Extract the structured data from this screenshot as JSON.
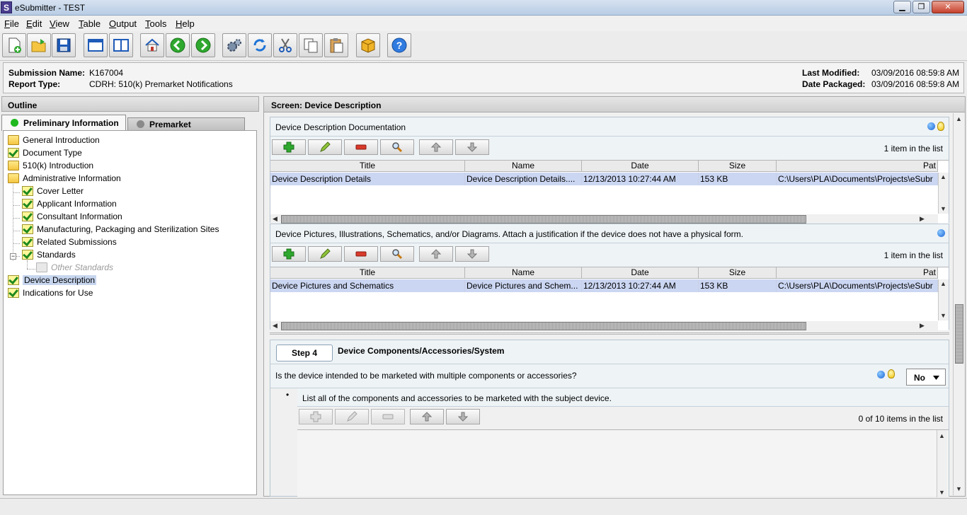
{
  "window": {
    "icon_letter": "S",
    "title": "eSubmitter - TEST",
    "minimize": "▁",
    "maximize": "❐",
    "close": "✕"
  },
  "menu": [
    {
      "mn": "F",
      "rest": "ile"
    },
    {
      "mn": "E",
      "rest": "dit"
    },
    {
      "mn": "V",
      "rest": "iew"
    },
    {
      "mn": "T",
      "rest": "able"
    },
    {
      "mn": "O",
      "rest": "utput"
    },
    {
      "mn": "T",
      "rest": "ools"
    },
    {
      "mn": "H",
      "rest": "elp"
    }
  ],
  "toolbar_icons": [
    "new-document-icon",
    "open-folder-icon",
    "save-icon",
    "window-icon",
    "split-view-icon",
    "home-icon",
    "back-arrow-icon",
    "forward-arrow-icon",
    "settings-gears-icon",
    "refresh-icon",
    "cut-icon",
    "copy-icon",
    "paste-icon",
    "package-icon",
    "help-icon"
  ],
  "submission": {
    "name_label": "Submission Name:",
    "name_value": "K167004",
    "type_label": "Report Type:",
    "type_value": "CDRH: 510(k) Premarket Notifications",
    "modified_label": "Last Modified:",
    "modified_value": "03/09/2016 08:59:8 AM",
    "packaged_label": "Date Packaged:",
    "packaged_value": "03/09/2016 08:59:8 AM"
  },
  "outline": {
    "header": "Outline",
    "tabs": [
      {
        "label": "Preliminary Information",
        "status_color": "#1fb81f"
      },
      {
        "label": "Premarket Notification",
        "status_color": "#8a8a8a"
      }
    ],
    "nodes": [
      {
        "label": "General Introduction",
        "icon": "folder"
      },
      {
        "label": "Document Type",
        "icon": "check"
      },
      {
        "label": "510(k) Introduction",
        "icon": "folder"
      },
      {
        "label": "Administrative Information",
        "icon": "folder"
      },
      {
        "label": "Cover Letter",
        "icon": "check"
      },
      {
        "label": "Applicant Information",
        "icon": "check"
      },
      {
        "label": "Consultant Information",
        "icon": "check"
      },
      {
        "label": "Manufacturing, Packaging and Sterilization Sites",
        "icon": "check"
      },
      {
        "label": "Related Submissions",
        "icon": "check"
      },
      {
        "label": "Standards",
        "icon": "check"
      },
      {
        "label": "Other Standards",
        "icon": "folder-disabled"
      },
      {
        "label": "Device Description",
        "icon": "check"
      },
      {
        "label": "Indications for Use",
        "icon": "check"
      }
    ],
    "expander": "−"
  },
  "screen": {
    "header": "Screen: Device Description",
    "section1": {
      "title": "Device Description Documentation",
      "count": "1 item in the list",
      "columns": [
        "Title",
        "Name",
        "Date",
        "Size",
        "Pat"
      ],
      "row": [
        "Device Description Details",
        "Device Description Details....",
        "12/13/2013 10:27:44 AM",
        "153 KB",
        "C:\\Users\\PLA\\Documents\\Projects\\eSubr"
      ]
    },
    "section2": {
      "title": "Device Pictures, Illustrations, Schematics, and/or Diagrams. Attach a justification if the device does not have a physical form.",
      "count": "1 item in the list",
      "columns": [
        "Title",
        "Name",
        "Date",
        "Size",
        "Pat"
      ],
      "row": [
        "Device Pictures and Schematics",
        "Device Pictures and Schem...",
        "12/13/2013 10:27:44 AM",
        "153 KB",
        "C:\\Users\\PLA\\Documents\\Projects\\eSubr"
      ]
    },
    "step": {
      "step_label": "Step 4",
      "title": "Device Components/Accessories/System",
      "question": "Is the device intended to be marketed with multiple components or accessories?",
      "answer": "No",
      "bullet": "•",
      "bullet_text": "List all of the components and accessories to be marketed with the subject device.",
      "count": "0 of 10 items in the list"
    }
  },
  "colors": {
    "info_blue": "#1863d6",
    "selection": "#cbd6f2",
    "add_green": "#2ea82e",
    "delete_red": "#d83a2a"
  }
}
